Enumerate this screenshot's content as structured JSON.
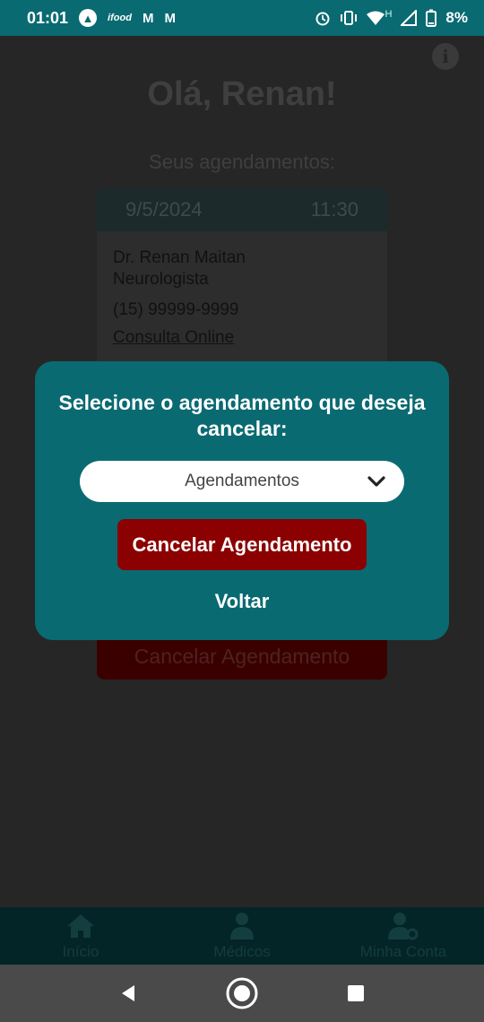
{
  "status_bar": {
    "time": "01:01",
    "battery": "8%",
    "network_type": "H",
    "left_icons": [
      "app-a-icon",
      "ifood-icon",
      "gmail-icon",
      "gmail-icon"
    ],
    "right_icons": [
      "alarm-icon",
      "vibrate-icon",
      "wifi-icon",
      "signal-icon",
      "battery-icon"
    ],
    "left_texts": [
      "▲",
      "ifood",
      "M",
      "M"
    ]
  },
  "app": {
    "greeting": "Olá, Renan!",
    "section_title": "Seus agendamentos:",
    "appointment": {
      "date": "9/5/2024",
      "time": "11:30",
      "doctor": "Dr. Renan Maitan",
      "specialty": "Neurologista",
      "phone": "(15) 99999-9999",
      "type": "Consulta Online",
      "cancel_label": "Cancelar Agendamento"
    }
  },
  "modal": {
    "title": "Selecione o agendamento que deseja cancelar:",
    "select_value": "Agendamentos",
    "cancel_button": "Cancelar Agendamento",
    "back_button": "Voltar"
  },
  "bottom_nav": {
    "items": [
      {
        "label": "Início",
        "icon": "home-icon"
      },
      {
        "label": "Médicos",
        "icon": "doctor-icon"
      },
      {
        "label": "Minha Conta",
        "icon": "user-settings-icon"
      }
    ]
  },
  "colors": {
    "primary": "#0a6a72",
    "danger": "#8b0000",
    "background": "#262626"
  }
}
